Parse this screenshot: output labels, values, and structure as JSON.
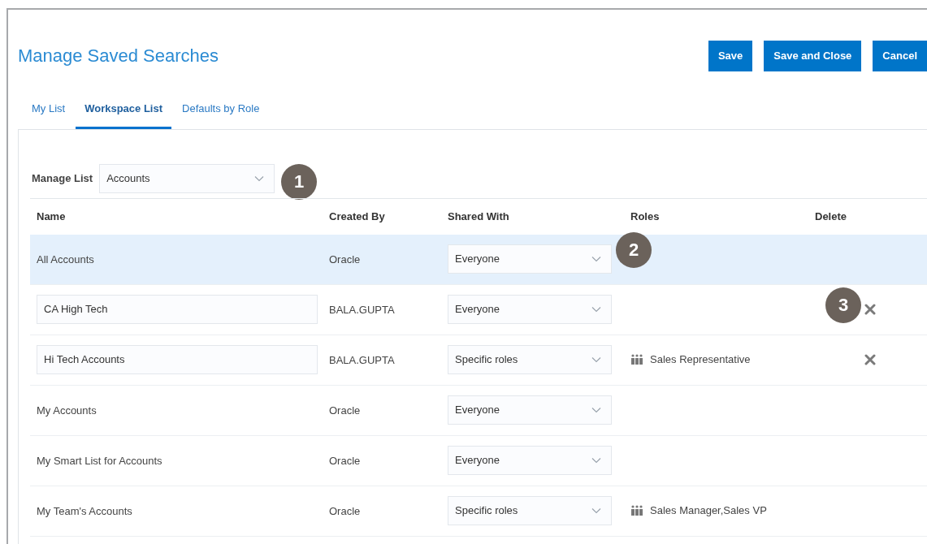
{
  "title": "Manage Saved Searches",
  "buttons": [
    "Save",
    "Save and Close",
    "Cancel"
  ],
  "tabs": [
    {
      "label": "My List",
      "selected": false
    },
    {
      "label": "Workspace List",
      "selected": true
    },
    {
      "label": "Defaults by Role",
      "selected": false
    }
  ],
  "manage_list": {
    "label": "Manage List",
    "value": "Accounts",
    "callout": "1"
  },
  "table": {
    "columns": [
      "Name",
      "Created By",
      "Shared With",
      "Roles",
      "Delete"
    ],
    "rows": [
      {
        "name": "All Accounts",
        "kind": "text",
        "created_by": "Oracle",
        "shared_with": "Everyone",
        "selected": true,
        "deletable": false,
        "shared_callout": "2"
      },
      {
        "name": "CA High Tech",
        "kind": "input",
        "created_by": "BALA.GUPTA",
        "shared_with": "Everyone",
        "selected": false,
        "deletable": true,
        "delete_callout": "3"
      },
      {
        "name": "Hi Tech Accounts",
        "kind": "input",
        "created_by": "BALA.GUPTA",
        "shared_with": "Specific roles",
        "roles": "Sales Representative",
        "selected": false,
        "deletable": true
      },
      {
        "name": "My Accounts",
        "kind": "text",
        "created_by": "Oracle",
        "shared_with": "Everyone",
        "selected": false,
        "deletable": false
      },
      {
        "name": "My Smart List for Accounts",
        "kind": "text",
        "created_by": "Oracle",
        "shared_with": "Everyone",
        "selected": false,
        "deletable": false
      },
      {
        "name": "My Team's Accounts",
        "kind": "text",
        "created_by": "Oracle",
        "shared_with": "Specific roles",
        "roles": "Sales Manager,Sales VP",
        "selected": false,
        "deletable": false
      }
    ]
  }
}
